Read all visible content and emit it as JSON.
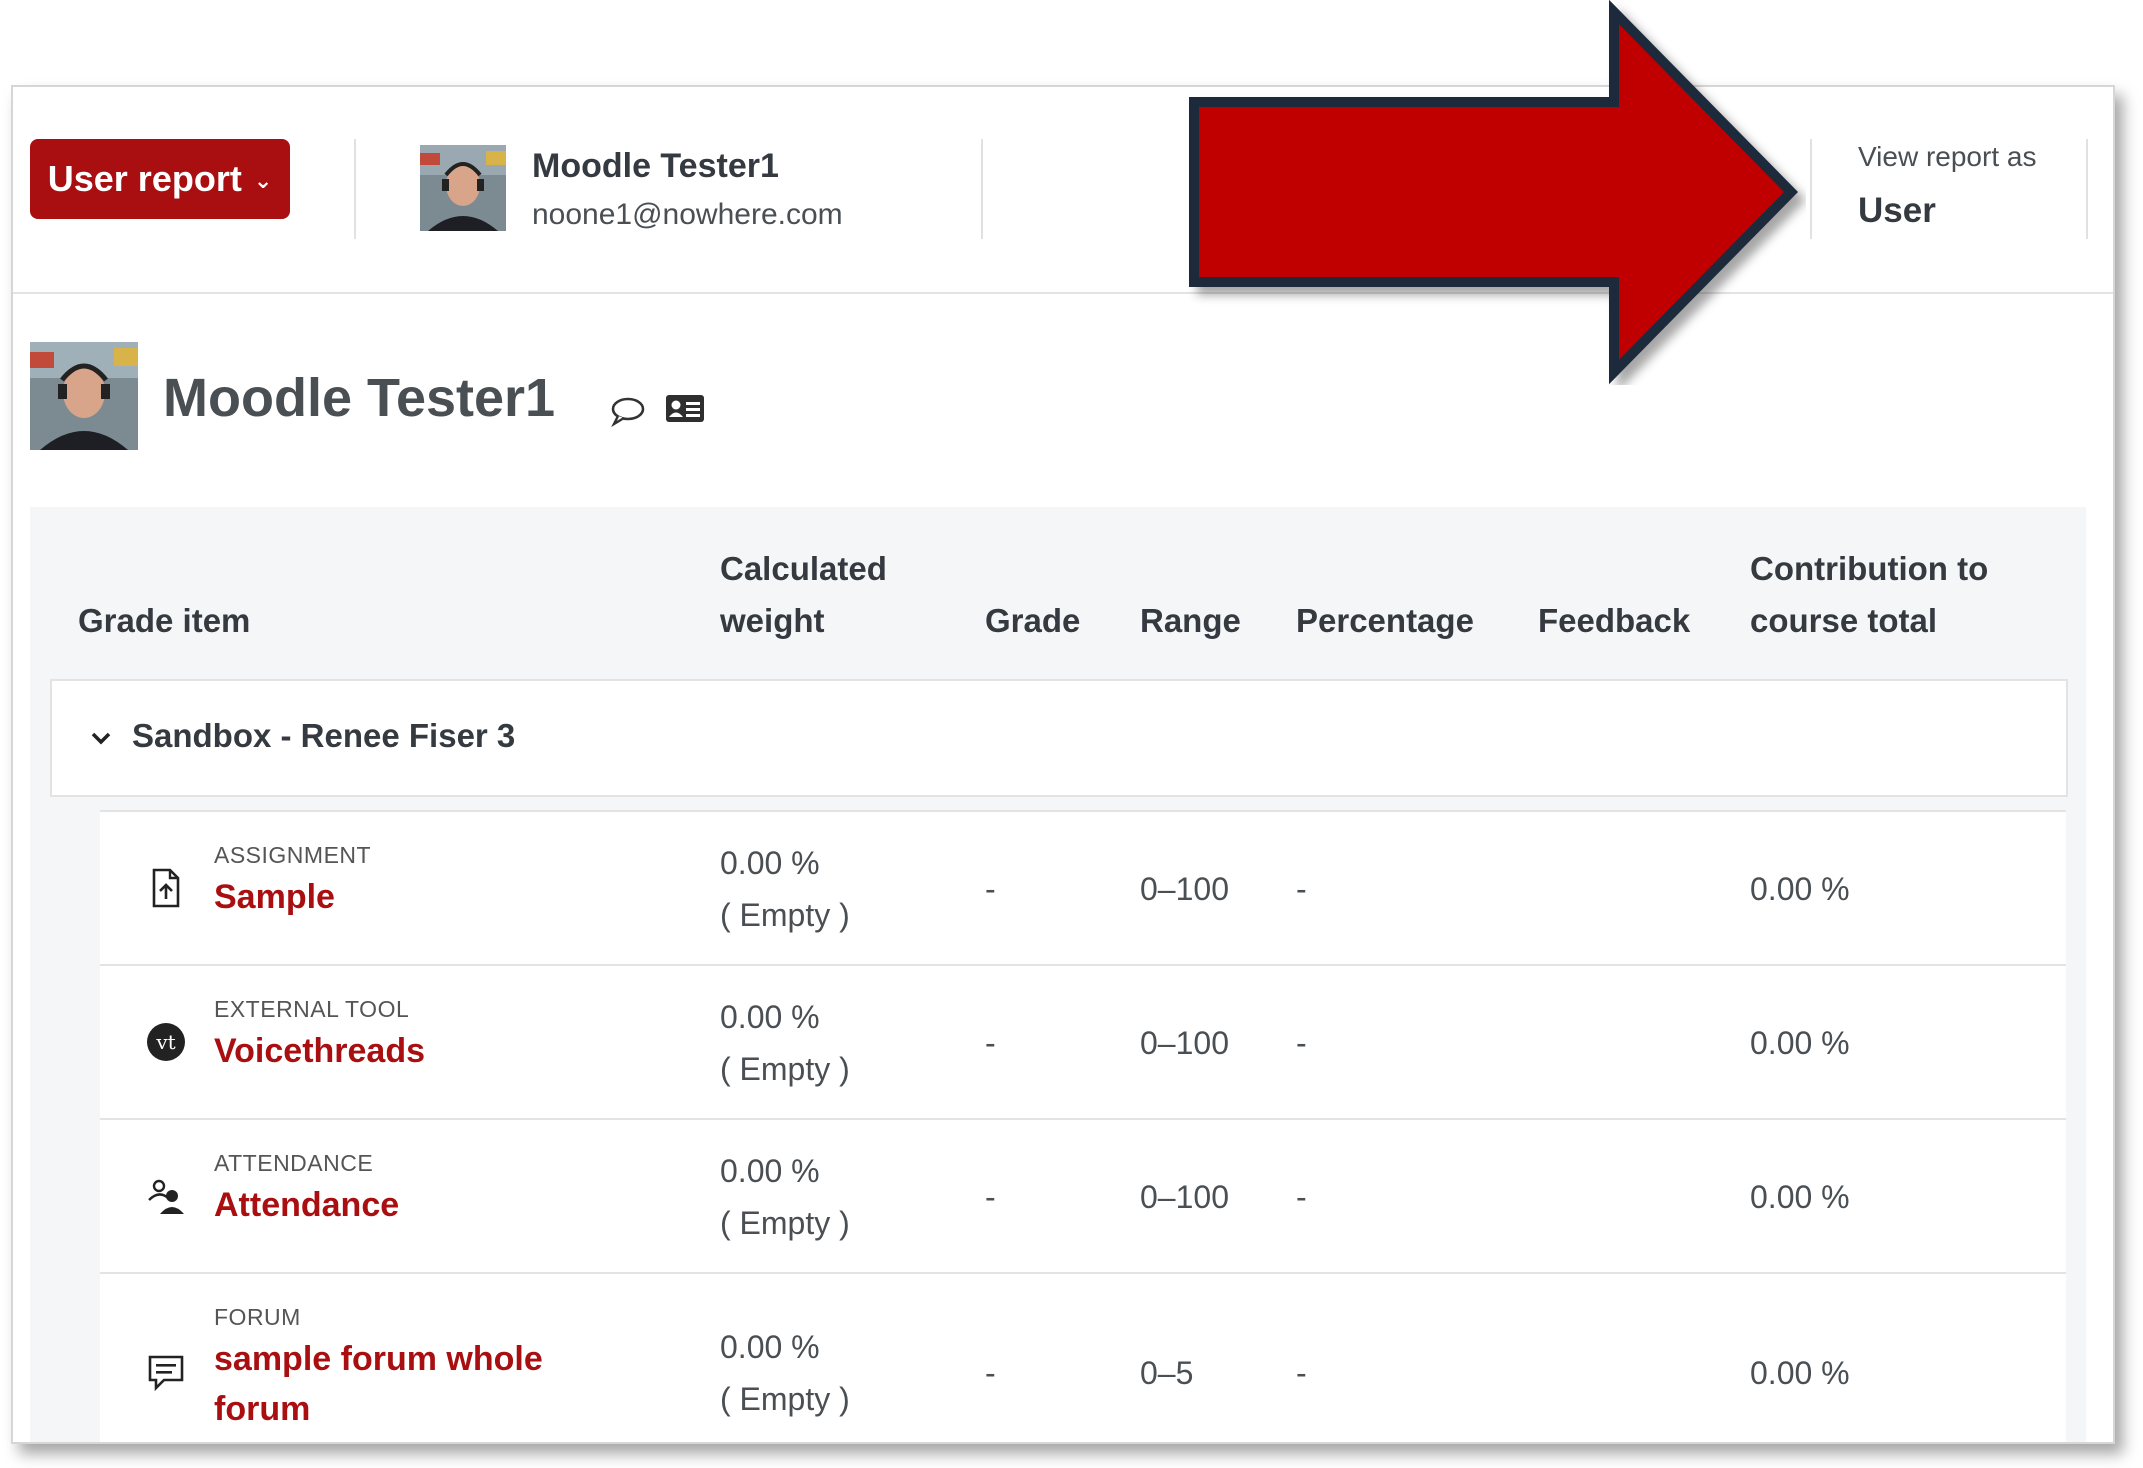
{
  "header": {
    "report_selector": "User report",
    "user_name": "Moodle Tester1",
    "user_email": "noone1@nowhere.com",
    "view_as_label": "View report as",
    "view_as_value": "User"
  },
  "user": {
    "title": "Moodle Tester1"
  },
  "table": {
    "columns": {
      "grade_item": "Grade item",
      "weight_line1": "Calculated",
      "weight_line2": "weight",
      "grade": "Grade",
      "range": "Range",
      "percentage": "Percentage",
      "feedback": "Feedback",
      "contrib_line1": "Contribution to",
      "contrib_line2": "course total"
    },
    "category": "Sandbox - Renee Fiser 3",
    "rows": [
      {
        "type": "ASSIGNMENT",
        "name": "Sample",
        "weight": "0.00 %",
        "weight_note": "( Empty )",
        "grade": "-",
        "range": "0–100",
        "percentage": "-",
        "contribution": "0.00 %"
      },
      {
        "type": "EXTERNAL TOOL",
        "name": "Voicethreads",
        "weight": "0.00 %",
        "weight_note": "( Empty )",
        "grade": "-",
        "range": "0–100",
        "percentage": "-",
        "contribution": "0.00 %"
      },
      {
        "type": "ATTENDANCE",
        "name": "Attendance",
        "weight": "0.00 %",
        "weight_note": "( Empty )",
        "grade": "-",
        "range": "0–100",
        "percentage": "-",
        "contribution": "0.00 %"
      },
      {
        "type": "FORUM",
        "name": "sample forum whole forum",
        "weight": "0.00 %",
        "weight_note": "( Empty )",
        "grade": "-",
        "range": "0–5",
        "percentage": "-",
        "contribution": "0.00 %"
      }
    ]
  },
  "colors": {
    "brand_red": "#a90f11",
    "arrow_red": "#c00000",
    "arrow_outline": "#1f2b3a"
  },
  "icons": {
    "row_0": "assignment-upload-icon",
    "row_1": "voicethread-vt-icon",
    "row_2": "attendance-people-icon",
    "row_3": "forum-message-icon"
  }
}
